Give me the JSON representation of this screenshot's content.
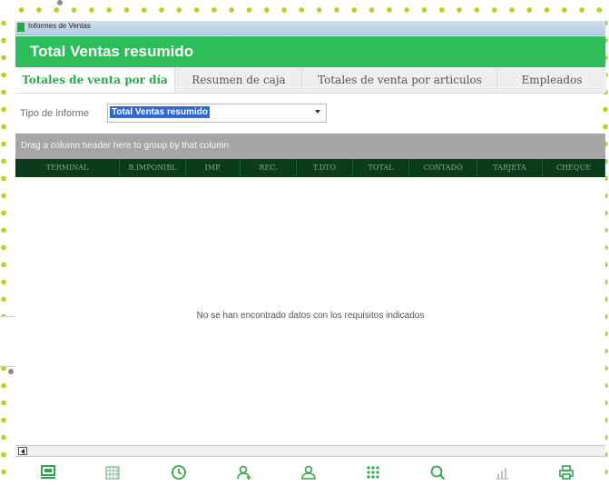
{
  "window": {
    "title": "Informes de Ventas"
  },
  "header": {
    "title": "Total Ventas resumido"
  },
  "tabs": [
    {
      "label": "Totales de venta por día",
      "active": true
    },
    {
      "label": "Resumen de caja",
      "active": false
    },
    {
      "label": "Totales de venta por articulos",
      "active": false
    },
    {
      "label": "Empleados",
      "active": false
    }
  ],
  "report_type": {
    "label": "Tipo de informe",
    "selected": "Total Ventas resumido"
  },
  "grid": {
    "group_hint": "Drag a column header here to group by that column",
    "columns": [
      "TERMINAL",
      "B.IMPONIBL",
      "IMP.",
      "REC.",
      "T.DTO",
      "TOTAL",
      "CONTADO",
      "TARJETA",
      "CHEQUE"
    ],
    "empty_message": "No se han encontrado datos con los requisitos indicados"
  },
  "toolbar_icons": [
    "terminal-icon",
    "calendar-grid-icon",
    "clock-history-icon",
    "add-user-icon",
    "users-icon",
    "keypad-icon",
    "search-icon",
    "chart-icon",
    "print-icon"
  ],
  "colors": {
    "accent": "#2ebd5b",
    "header_dark": "#0a3b1d",
    "icon_green": "#2aa84a"
  }
}
